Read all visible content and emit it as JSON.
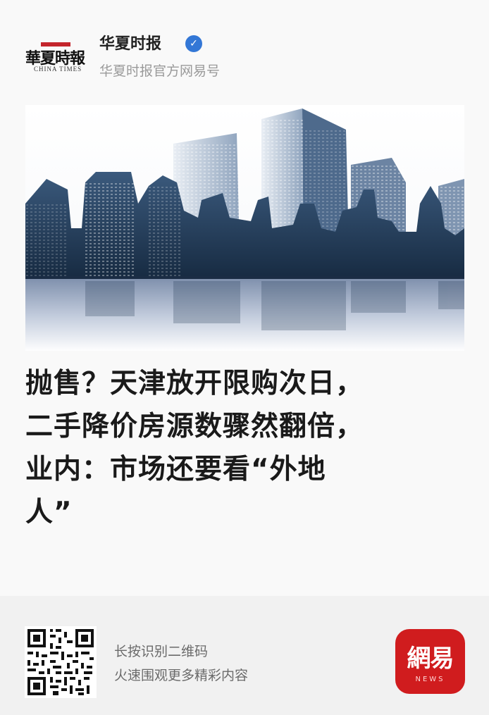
{
  "header": {
    "logo_text_cn": "華夏時報",
    "logo_text_en": "CHINA TIMES",
    "source_name": "华夏时报",
    "verified_mark": "✓",
    "source_subtitle": "华夏时报官方网易号"
  },
  "hero": {
    "icon": "city-skyline-image"
  },
  "article": {
    "headline_lines": [
      "抛售？天津放开限购次日，",
      "二手降价房源数骤然翻倍，",
      "业内：市场还要看“外地",
      "人”"
    ]
  },
  "footer": {
    "line1": "长按识别二维码",
    "line2": "火速围观更多精彩内容",
    "badge_text": "網易",
    "badge_sub": "NEWS"
  },
  "colors": {
    "brand_red": "#d01c1e",
    "verified_blue": "#3377d6",
    "skyline_navy": "#1e3550"
  }
}
